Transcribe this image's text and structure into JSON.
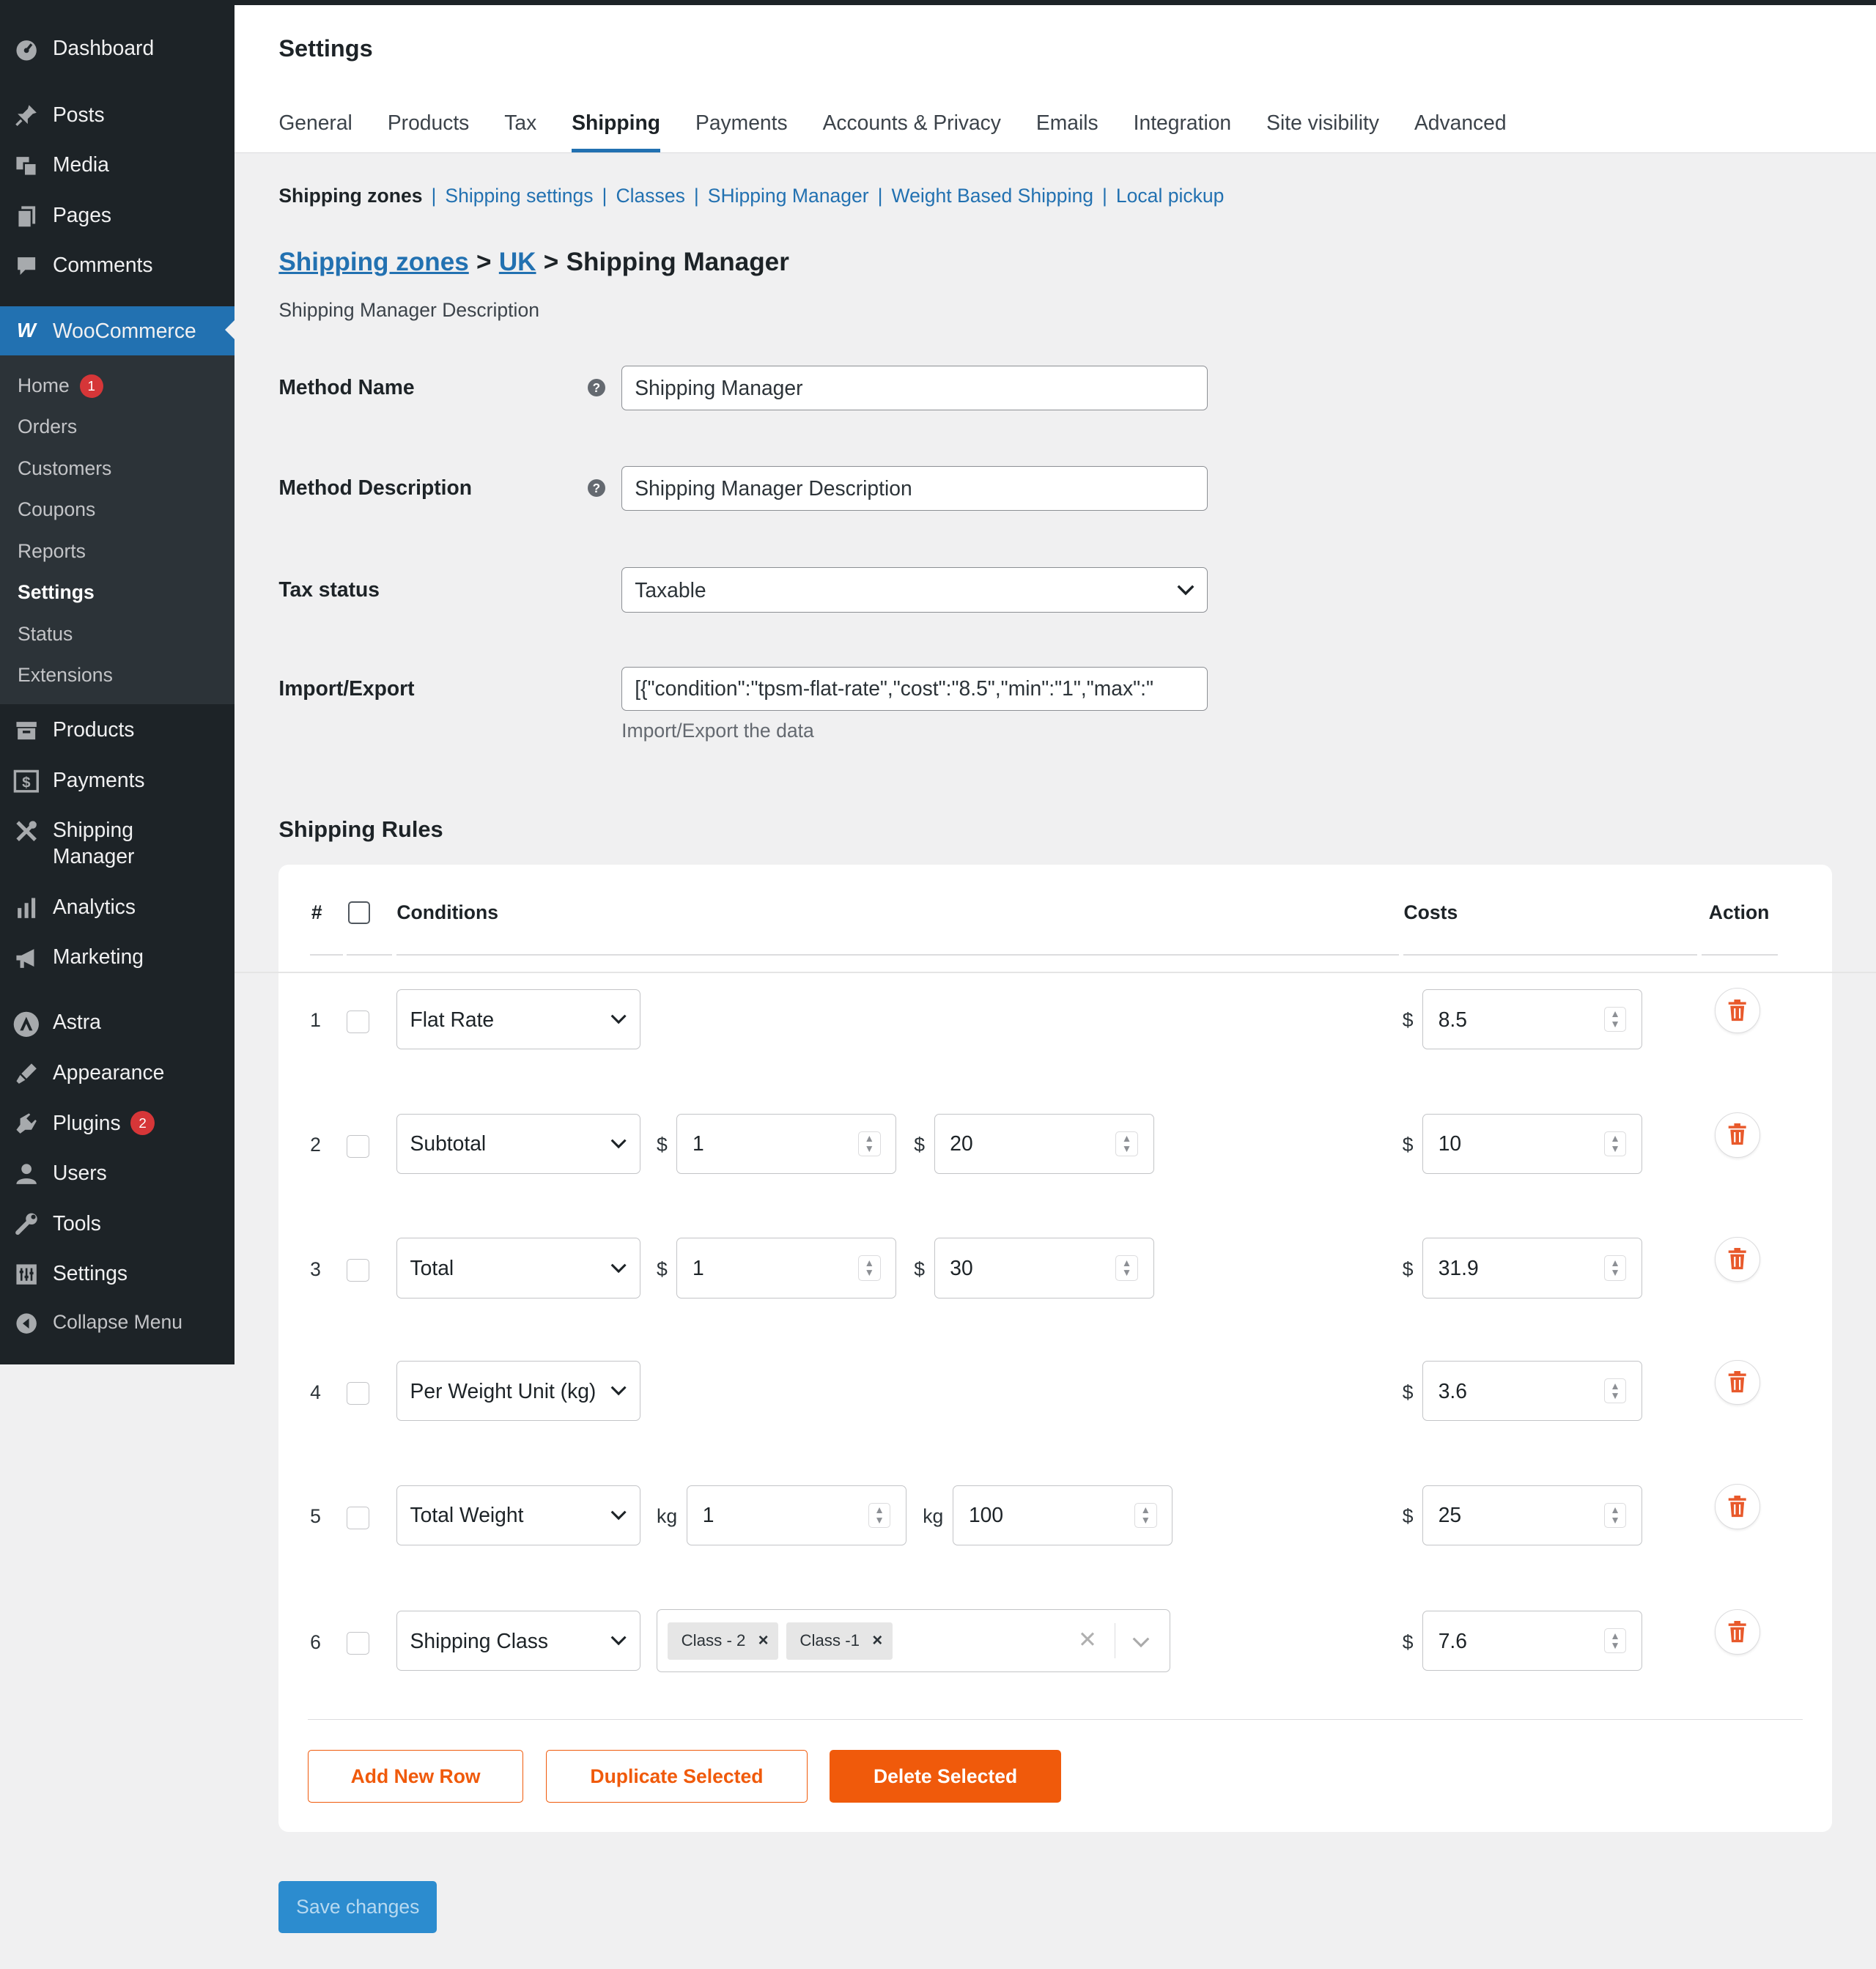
{
  "sidebar": {
    "top_items": [
      {
        "label": "Dashboard",
        "icon": "dashboard-icon"
      },
      {
        "label": "Posts",
        "icon": "pin-icon"
      },
      {
        "label": "Media",
        "icon": "media-icon"
      },
      {
        "label": "Pages",
        "icon": "pages-icon"
      },
      {
        "label": "Comments",
        "icon": "comments-icon"
      }
    ],
    "woocommerce": {
      "label": "WooCommerce",
      "icon_glyph": "W"
    },
    "woo_submenu": [
      {
        "label": "Home",
        "badge": "1"
      },
      {
        "label": "Orders"
      },
      {
        "label": "Customers"
      },
      {
        "label": "Coupons"
      },
      {
        "label": "Reports"
      },
      {
        "label": "Settings"
      },
      {
        "label": "Status"
      },
      {
        "label": "Extensions"
      }
    ],
    "lower_items": [
      {
        "label": "Products",
        "icon": "archive-icon"
      },
      {
        "label": "Payments",
        "icon": "payments-icon"
      },
      {
        "label": "Shipping",
        "label2": "Manager",
        "icon": "shipping-icon"
      },
      {
        "label": "Analytics",
        "icon": "analytics-icon"
      },
      {
        "label": "Marketing",
        "icon": "megaphone-icon"
      },
      {
        "label": "Astra",
        "icon": "astra-icon"
      },
      {
        "label": "Appearance",
        "icon": "brush-icon"
      },
      {
        "label": "Plugins",
        "badge": "2",
        "icon": "plugins-icon"
      },
      {
        "label": "Users",
        "icon": "users-icon"
      },
      {
        "label": "Tools",
        "icon": "wrench-icon"
      },
      {
        "label": "Settings",
        "icon": "settings-icon"
      }
    ],
    "collapse": "Collapse Menu"
  },
  "header": {
    "title": "Settings",
    "tabs": [
      "General",
      "Products",
      "Tax",
      "Shipping",
      "Payments",
      "Accounts & Privacy",
      "Emails",
      "Integration",
      "Site visibility",
      "Advanced"
    ]
  },
  "subnav": {
    "current": "Shipping zones",
    "links": [
      "Shipping settings",
      "Classes",
      "SHipping Manager",
      "Weight Based Shipping",
      "Local pickup"
    ]
  },
  "breadcrumb": {
    "zones": "Shipping zones",
    "zone": "UK",
    "sep": ">",
    "current": "Shipping Manager"
  },
  "description": "Shipping Manager Description",
  "form": {
    "method_name_label": "Method Name",
    "method_name_value": "Shipping Manager",
    "method_desc_label": "Method Description",
    "method_desc_value": "Shipping Manager Description",
    "tax_label": "Tax status",
    "tax_value": "Taxable",
    "import_label": "Import/Export",
    "import_value": "[{\"condition\":\"tpsm-flat-rate\",\"cost\":\"8.5\",\"min\":\"1\",\"max\":\"",
    "import_help": "Import/Export the data",
    "help_glyph": "?"
  },
  "rules": {
    "title": "Shipping Rules",
    "headers": {
      "num": "#",
      "conditions": "Conditions",
      "costs": "Costs",
      "action": "Action"
    },
    "currency": "$",
    "weight_unit": "kg",
    "rows": [
      {
        "n": "1",
        "condition": "Flat Rate",
        "cost": "8.5"
      },
      {
        "n": "2",
        "condition": "Subtotal",
        "min": "1",
        "max": "20",
        "cost": "10"
      },
      {
        "n": "3",
        "condition": "Total",
        "min": "1",
        "max": "30",
        "cost": "31.9"
      },
      {
        "n": "4",
        "condition": "Per Weight Unit (kg)",
        "cost": "3.6"
      },
      {
        "n": "5",
        "condition": "Total Weight",
        "min": "1",
        "max": "100",
        "cost": "25"
      },
      {
        "n": "6",
        "condition": "Shipping Class",
        "classes": [
          "Class - 2",
          "Class -1"
        ],
        "cost": "7.6"
      }
    ],
    "buttons": {
      "add": "Add New Row",
      "duplicate": "Duplicate Selected",
      "delete": "Delete Selected"
    }
  },
  "save": "Save changes",
  "colors": {
    "accent": "#2271b1",
    "orange": "#f05a0b",
    "sidebar": "#1d2327"
  }
}
